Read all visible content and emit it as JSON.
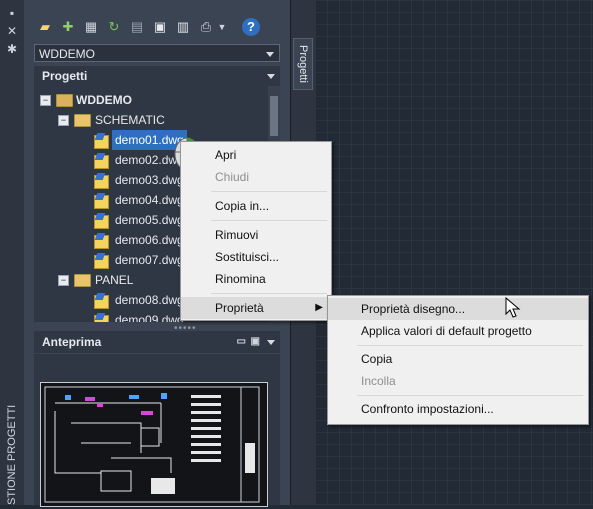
{
  "left_strip": {
    "icons": [
      "pin-icon",
      "close-icon",
      "settings-icon"
    ],
    "title": "STIONE PROGETTI"
  },
  "toolbar": {
    "buttons": [
      "open-project-icon",
      "new-project-icon",
      "new-drawing-icon",
      "refresh-icon",
      "project-properties-icon",
      "drawing-list-icon",
      "reports-icon",
      "plot-icon",
      "help-icon"
    ]
  },
  "project_select": {
    "value": "WDDEMO"
  },
  "projects_section": {
    "title": "Progetti"
  },
  "tree": {
    "root": "WDDEMO",
    "folders": [
      "SCHEMATIC",
      "PANEL"
    ],
    "items": [
      "demo01.dwg",
      "demo02.dwg",
      "demo03.dwg",
      "demo04.dwg",
      "demo05.dwg",
      "demo06.dwg",
      "demo07.dwg",
      "demo08.dwg",
      "demo09.dwg"
    ],
    "selected": "demo01.dwg"
  },
  "preview_section": {
    "title": "Anteprima"
  },
  "side_tab": {
    "label": "Progetti"
  },
  "context_menu": {
    "items": [
      "Apri",
      "Chiudi",
      "Copia in...",
      "Rimuovi",
      "Sostituisci...",
      "Rinomina",
      "Proprietà"
    ],
    "disabled": [
      "Chiudi"
    ],
    "highlighted": "Proprietà"
  },
  "submenu": {
    "items": [
      "Proprietà disegno...",
      "Applica valori di default progetto",
      "Copia",
      "Incolla",
      "Confronto impostazioni..."
    ],
    "disabled": [
      "Incolla"
    ],
    "highlighted": "Proprietà disegno..."
  },
  "colors": {
    "canvas": "#222a35",
    "palette": "#3b4453",
    "selection": "#2f6fbf",
    "menu": "#f0f0f0"
  }
}
